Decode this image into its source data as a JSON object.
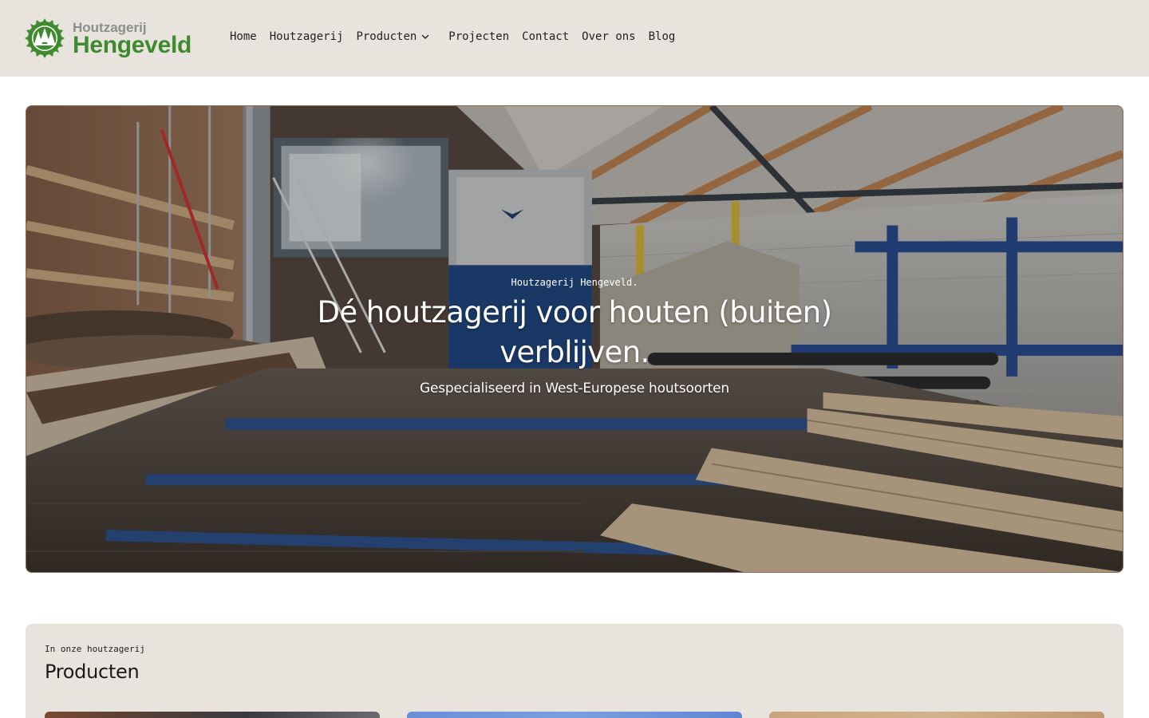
{
  "header": {
    "logo": {
      "top_text": "Houtzagerij",
      "main_text": "Hengeveld",
      "brand_color": "#3f8a2f",
      "emblem_icon": "saw-blade-forest-icon"
    },
    "nav": [
      {
        "label": "Home"
      },
      {
        "label": "Houtzagerij"
      },
      {
        "label": "Producten",
        "has_submenu": true,
        "icon": "chevron-down-icon"
      },
      {
        "label": "Projecten"
      },
      {
        "label": "Contact"
      },
      {
        "label": "Over ons"
      },
      {
        "label": "Blog"
      }
    ]
  },
  "hero": {
    "eyebrow": "Houtzagerij Hengeveld.",
    "title": "Dé houtzagerij voor houten (buiten) verblijven.",
    "subtitle": "Gespecialiseerd in West-Europese houtsoorten",
    "image": "sawmill-interior-photo"
  },
  "products": {
    "eyebrow": "In onze houtzagerij",
    "title": "Producten",
    "cards": [
      {
        "image": "product-image-1"
      },
      {
        "image": "product-image-2"
      },
      {
        "image": "product-image-3"
      }
    ]
  },
  "colors": {
    "header_bg": "#e8e4dd",
    "section_bg": "#e8e4dd",
    "text": "#1f1f1f",
    "brand_green": "#3f8a2f",
    "brand_grey": "#8a8f8a"
  }
}
